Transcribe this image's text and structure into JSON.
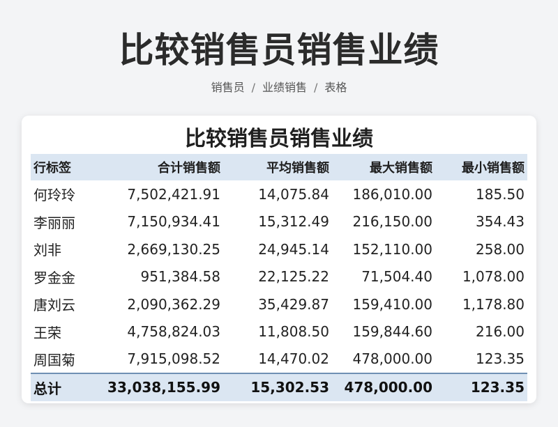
{
  "page": {
    "title": "比较销售员销售业绩",
    "breadcrumb": [
      "销售员",
      "业绩销售",
      "表格"
    ]
  },
  "table": {
    "title": "比较销售员销售业绩",
    "headers": [
      "行标签",
      "合计销售额",
      "平均销售额",
      "最大销售额",
      "最小销售额"
    ],
    "rows": [
      [
        "何玲玲",
        "7,502,421.91",
        "14,075.84",
        "186,010.00",
        "185.50"
      ],
      [
        "李丽丽",
        "7,150,934.41",
        "15,312.49",
        "216,150.00",
        "354.43"
      ],
      [
        "刘非",
        "2,669,130.25",
        "24,945.14",
        "152,110.00",
        "258.00"
      ],
      [
        "罗金金",
        "951,384.58",
        "22,125.22",
        "71,504.40",
        "1,078.00"
      ],
      [
        "唐刘云",
        "2,090,362.29",
        "35,429.87",
        "159,410.00",
        "1,178.80"
      ],
      [
        "王荣",
        "4,758,824.03",
        "11,808.50",
        "159,844.60",
        "216.00"
      ],
      [
        "周国菊",
        "7,915,098.52",
        "14,470.02",
        "478,000.00",
        "123.35"
      ]
    ],
    "total": [
      "总计",
      "33,038,155.99",
      "15,302.53",
      "478,000.00",
      "123.35"
    ]
  },
  "colors": {
    "header_bg": "#dbe6f2",
    "page_bg": "#f3f4f6",
    "card_bg": "#ffffff"
  }
}
